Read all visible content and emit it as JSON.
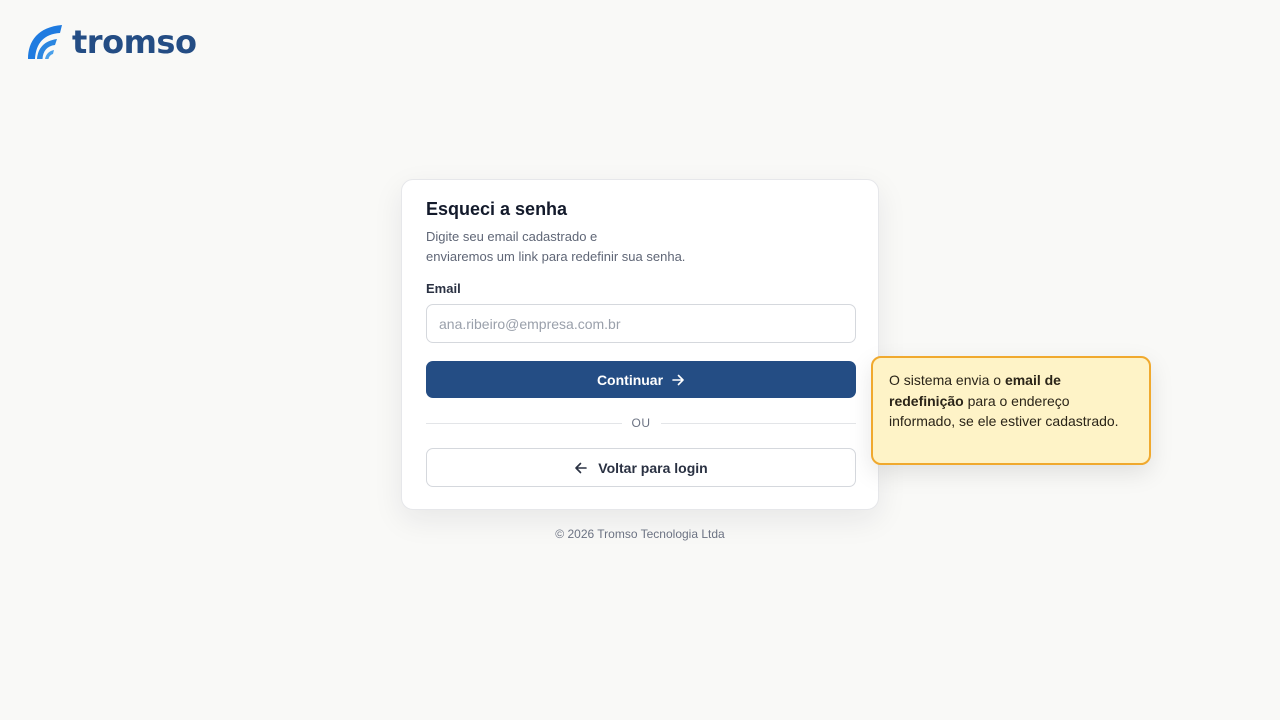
{
  "brand": {
    "name": "tromso",
    "color": "#244d84",
    "accent": "#2b86e0"
  },
  "card": {
    "title": "Esqueci a senha",
    "subtitle_line1": "Digite seu email cadastrado e",
    "subtitle_line2": "enviaremos um link para redefinir sua senha.",
    "email_label": "Email",
    "email_placeholder": "ana.ribeiro@empresa.com.br",
    "email_value": "",
    "continue_label": "Continuar",
    "continue_icon": "arrow-right-icon",
    "divider_label": "OU",
    "back_label": "Voltar para login",
    "back_icon": "arrow-left-icon"
  },
  "footer": {
    "copyright": "© 2026 Tromso Tecnologia Ltda"
  },
  "tooltip": {
    "text_before": "O sistema envia o ",
    "text_bold": "email de redefinição",
    "text_after": " para o endereço informado, se ele estiver cadastrado.",
    "background": "#fef3c7",
    "border": "#f0a92e"
  }
}
